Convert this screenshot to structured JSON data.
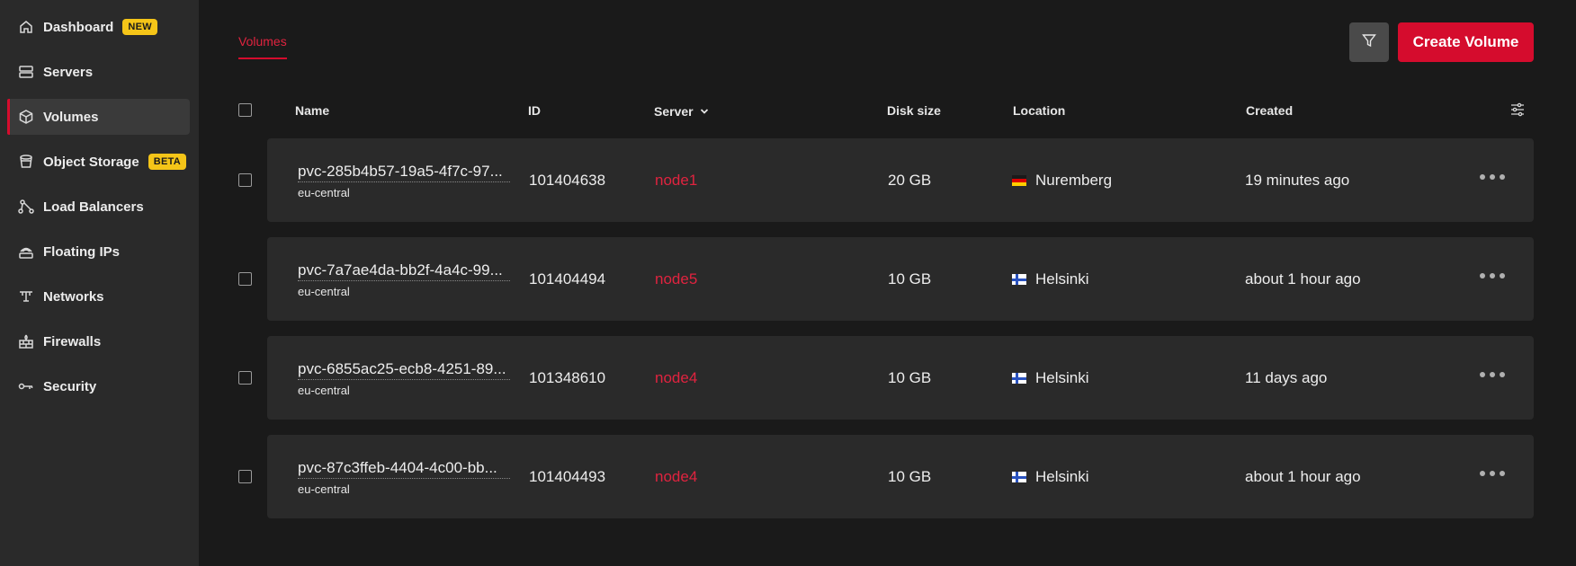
{
  "sidebar": {
    "items": [
      {
        "label": "Dashboard",
        "badge": "NEW",
        "icon": "home-icon"
      },
      {
        "label": "Servers",
        "icon": "servers-icon"
      },
      {
        "label": "Volumes",
        "icon": "volume-icon",
        "active": true
      },
      {
        "label": "Object Storage",
        "badge": "BETA",
        "icon": "bucket-icon"
      },
      {
        "label": "Load Balancers",
        "icon": "load-balancer-icon"
      },
      {
        "label": "Floating IPs",
        "icon": "floating-ip-icon"
      },
      {
        "label": "Networks",
        "icon": "network-icon"
      },
      {
        "label": "Firewalls",
        "icon": "firewall-icon"
      },
      {
        "label": "Security",
        "icon": "key-icon"
      }
    ]
  },
  "header": {
    "tab": "Volumes",
    "create_label": "Create Volume",
    "filter_icon": "filter-icon"
  },
  "table": {
    "columns": {
      "name": "Name",
      "id": "ID",
      "server": "Server",
      "disk_size": "Disk size",
      "location": "Location",
      "created": "Created"
    },
    "rows": [
      {
        "name": "pvc-285b4b57-19a5-4f7c-97...",
        "region": "eu-central",
        "id": "101404638",
        "server": "node1",
        "disk_size": "20 GB",
        "location": "Nuremberg",
        "flag": "de",
        "created": "19 minutes ago"
      },
      {
        "name": "pvc-7a7ae4da-bb2f-4a4c-99...",
        "region": "eu-central",
        "id": "101404494",
        "server": "node5",
        "disk_size": "10 GB",
        "location": "Helsinki",
        "flag": "fi",
        "created": "about 1 hour ago"
      },
      {
        "name": "pvc-6855ac25-ecb8-4251-89...",
        "region": "eu-central",
        "id": "101348610",
        "server": "node4",
        "disk_size": "10 GB",
        "location": "Helsinki",
        "flag": "fi",
        "created": "11 days ago"
      },
      {
        "name": "pvc-87c3ffeb-4404-4c00-bb...",
        "region": "eu-central",
        "id": "101404493",
        "server": "node4",
        "disk_size": "10 GB",
        "location": "Helsinki",
        "flag": "fi",
        "created": "about 1 hour ago"
      }
    ]
  },
  "colors": {
    "accent": "#d50c2d",
    "badge": "#f5c518",
    "sidebar_bg": "#2a2a2a",
    "page_bg": "#1a1a1a",
    "row_bg": "#2a2a2a"
  }
}
